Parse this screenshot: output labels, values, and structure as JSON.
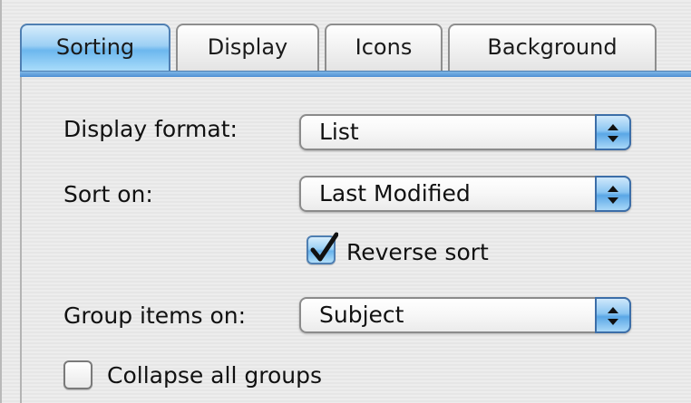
{
  "tabs": [
    {
      "label": "Sorting",
      "selected": true
    },
    {
      "label": "Display",
      "selected": false
    },
    {
      "label": "Icons",
      "selected": false
    },
    {
      "label": "Background",
      "selected": false
    }
  ],
  "form": {
    "display_format": {
      "label": "Display format:",
      "value": "List"
    },
    "sort_on": {
      "label": "Sort on:",
      "value": "Last Modified"
    },
    "reverse_sort": {
      "label": "Reverse sort",
      "checked": true
    },
    "group_items_on": {
      "label": "Group items on:",
      "value": "Subject"
    },
    "collapse_all_groups": {
      "label": "Collapse all groups",
      "checked": false
    }
  },
  "icons": {
    "popup_arrows": "up-down-arrows-icon",
    "checkmark": "checkmark-icon"
  },
  "colors": {
    "accent": "#6cb7ee",
    "accent_border": "#4f7fb2",
    "background": "#ececec"
  }
}
